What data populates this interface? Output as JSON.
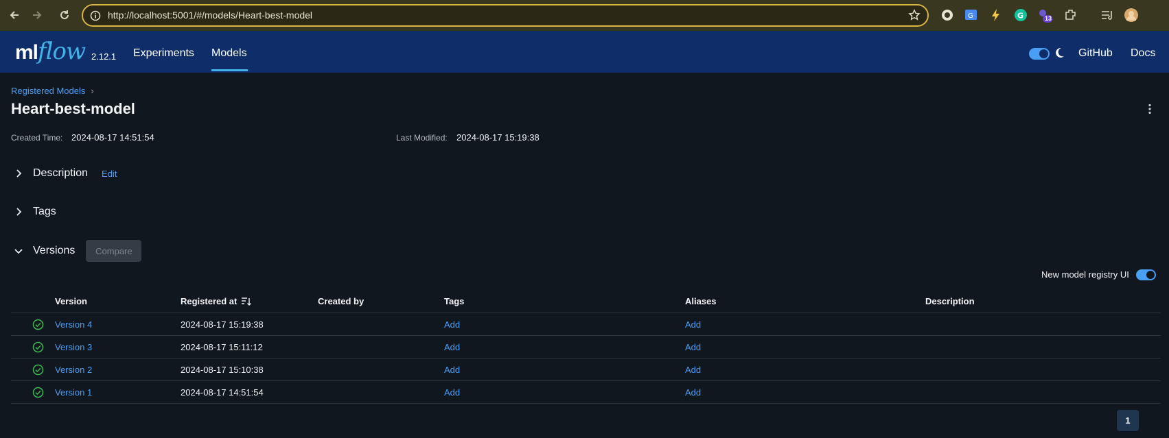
{
  "browser": {
    "url": "http://localhost:5001/#/models/Heart-best-model",
    "extension_badge": "13"
  },
  "header": {
    "logo_ml": "ml",
    "logo_flow": "flow",
    "version": "2.12.1",
    "nav": [
      "Experiments",
      "Models"
    ],
    "active_nav": "Models",
    "right_links": [
      "GitHub",
      "Docs"
    ],
    "accent": "#43b1e6"
  },
  "page": {
    "breadcrumb": "Registered Models",
    "title": "Heart-best-model",
    "created_label": "Created Time:",
    "created_value": "2024-08-17 14:51:54",
    "modified_label": "Last Modified:",
    "modified_value": "2024-08-17 15:19:38",
    "sections": {
      "description": "Description",
      "edit": "Edit",
      "tags": "Tags",
      "versions": "Versions",
      "compare": "Compare"
    },
    "registry_toggle_label": "New model registry UI"
  },
  "table": {
    "columns": [
      "Version",
      "Registered at",
      "Created by",
      "Tags",
      "Aliases",
      "Description"
    ],
    "rows": [
      {
        "version": "Version 4",
        "registered_at": "2024-08-17 15:19:38",
        "created_by": "",
        "tags": "Add",
        "aliases": "Add",
        "description": ""
      },
      {
        "version": "Version 3",
        "registered_at": "2024-08-17 15:11:12",
        "created_by": "",
        "tags": "Add",
        "aliases": "Add",
        "description": ""
      },
      {
        "version": "Version 2",
        "registered_at": "2024-08-17 15:10:38",
        "created_by": "",
        "tags": "Add",
        "aliases": "Add",
        "description": ""
      },
      {
        "version": "Version 1",
        "registered_at": "2024-08-17 14:51:54",
        "created_by": "",
        "tags": "Add",
        "aliases": "Add",
        "description": ""
      }
    ]
  },
  "pagination": {
    "current_page": "1"
  },
  "colors": {
    "status_ready": "#3fb950",
    "link": "#4a9ff5",
    "header_bg": "#0f2e69"
  }
}
